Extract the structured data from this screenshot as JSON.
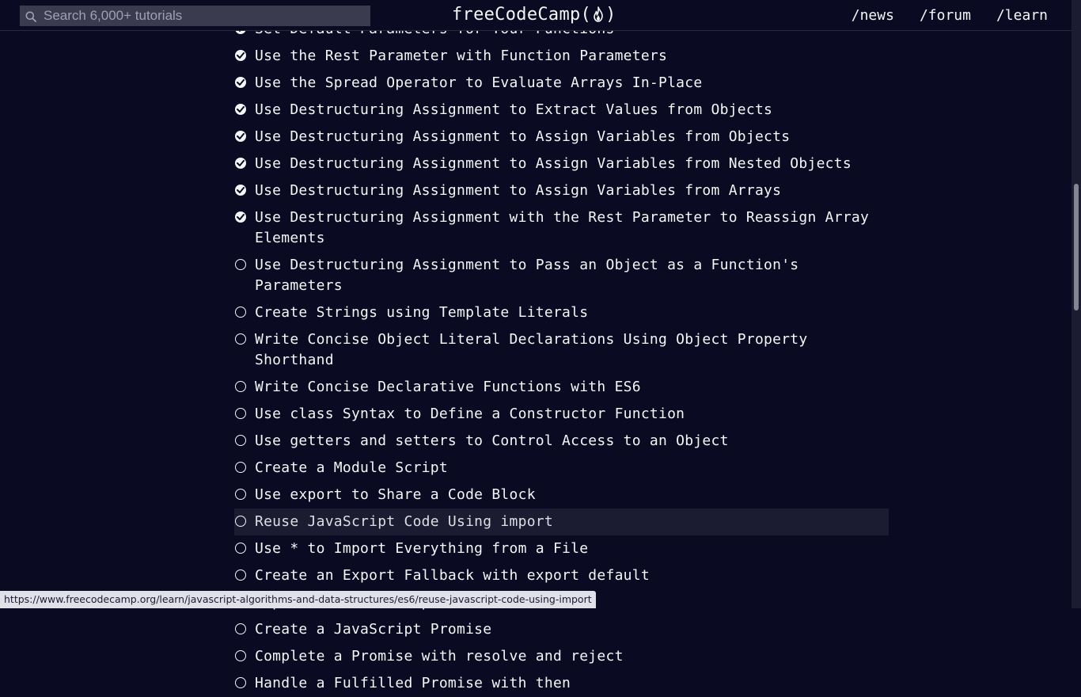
{
  "nav": {
    "search_placeholder": "Search 6,000+ tutorials",
    "brand_prefix": "freeCodeCamp(",
    "brand_suffix": ")",
    "links": [
      "/news",
      "/forum",
      "/learn"
    ]
  },
  "challenges": [
    {
      "title": "Set Default Parameters for Your Functions",
      "completed": true
    },
    {
      "title": "Use the Rest Parameter with Function Parameters",
      "completed": true
    },
    {
      "title": "Use the Spread Operator to Evaluate Arrays In-Place",
      "completed": true
    },
    {
      "title": "Use Destructuring Assignment to Extract Values from Objects",
      "completed": true
    },
    {
      "title": "Use Destructuring Assignment to Assign Variables from Objects",
      "completed": true
    },
    {
      "title": "Use Destructuring Assignment to Assign Variables from Nested Objects",
      "completed": true
    },
    {
      "title": "Use Destructuring Assignment to Assign Variables from Arrays",
      "completed": true
    },
    {
      "title": "Use Destructuring Assignment with the Rest Parameter to Reassign Array Elements",
      "completed": true
    },
    {
      "title": "Use Destructuring Assignment to Pass an Object as a Function's Parameters",
      "completed": false
    },
    {
      "title": "Create Strings using Template Literals",
      "completed": false
    },
    {
      "title": "Write Concise Object Literal Declarations Using Object Property Shorthand",
      "completed": false
    },
    {
      "title": "Write Concise Declarative Functions with ES6",
      "completed": false
    },
    {
      "title": "Use class Syntax to Define a Constructor Function",
      "completed": false
    },
    {
      "title": "Use getters and setters to Control Access to an Object",
      "completed": false
    },
    {
      "title": "Create a Module Script",
      "completed": false
    },
    {
      "title": "Use export to Share a Code Block",
      "completed": false
    },
    {
      "title": "Reuse JavaScript Code Using import",
      "completed": false,
      "hovered": true
    },
    {
      "title": "Use * to Import Everything from a File",
      "completed": false
    },
    {
      "title": "Create an Export Fallback with export default",
      "completed": false
    },
    {
      "title": "Import a Default Export",
      "completed": false
    },
    {
      "title": "Create a JavaScript Promise",
      "completed": false
    },
    {
      "title": "Complete a Promise with resolve and reject",
      "completed": false
    },
    {
      "title": "Handle a Fulfilled Promise with then",
      "completed": false
    }
  ],
  "status_url": "https://www.freecodecamp.org/learn/javascript-algorithms-and-data-structures/es6/reuse-javascript-code-using-import",
  "colors": {
    "background": "#0a0a23",
    "search_bg": "#3b3b4f",
    "hover_row": "#1b1b32",
    "text": "#f5f6f7"
  }
}
